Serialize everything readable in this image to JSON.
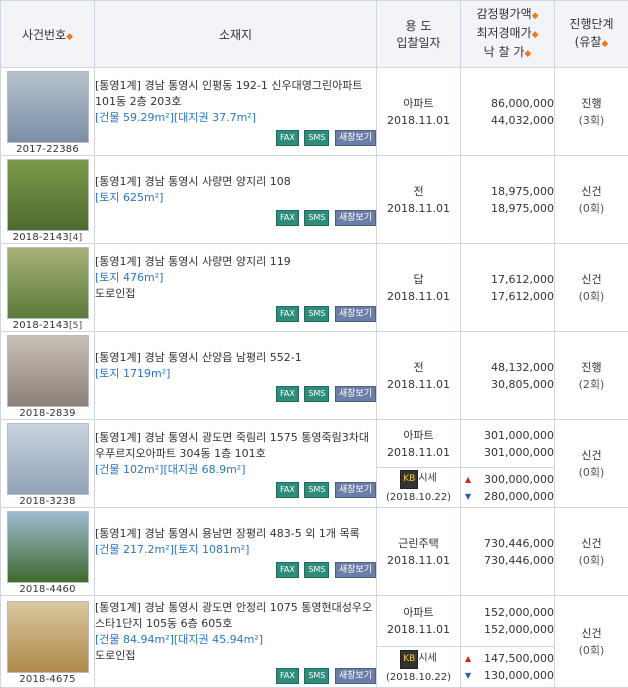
{
  "header": {
    "case": "사건번호",
    "location": "소재지",
    "usage_line1": "용 도",
    "usage_line2": "입찰일자",
    "price_line1": "감정평가액",
    "price_line2": "최저경매가",
    "price_line3": "낙 찰 가",
    "status_line1": "진행단계",
    "status_line2": "(유찰",
    "sort_glyph": "◆"
  },
  "buttons": {
    "fax": "FAX",
    "sms": "SMS",
    "new": "새창보기"
  },
  "rows": [
    {
      "case": "2017-22386",
      "case_sub": "",
      "court": "[통영1계]",
      "address": "경남 통영시 인평동 192-1 신우대영그린아파트 101동 2층 203호",
      "size": "[건물 59.29m²][대지권 37.7m²]",
      "note": "",
      "usage": "아파트",
      "date": "2018.11.01",
      "appraisal": "86,000,000",
      "minimum": "44,032,000",
      "status": "진행",
      "status_sub": "(3회)",
      "colors": [
        "#7a8fa6",
        "#b6c2cc"
      ]
    },
    {
      "case": "2018-2143",
      "case_sub": "[4]",
      "court": "[통영1계]",
      "address": "경남 통영시 사량면 양지리 108",
      "size": "[토지 625m²]",
      "note": "",
      "usage": "전",
      "date": "2018.11.01",
      "appraisal": "18,975,000",
      "minimum": "18,975,000",
      "status": "신건",
      "status_sub": "(0회)",
      "colors": [
        "#4d6b2e",
        "#7a9a4a"
      ]
    },
    {
      "case": "2018-2143",
      "case_sub": "[5]",
      "court": "[통영1계]",
      "address": "경남 통영시 사량면 양지리 119",
      "size": "[토지 476m²]",
      "note": "도로인접",
      "usage": "답",
      "date": "2018.11.01",
      "appraisal": "17,612,000",
      "minimum": "17,612,000",
      "status": "신건",
      "status_sub": "(0회)",
      "colors": [
        "#5b7a3a",
        "#a6b27a"
      ]
    },
    {
      "case": "2018-2839",
      "case_sub": "",
      "court": "[통영1계]",
      "address": "경남 통영시 산양읍 남평리 552-1",
      "size": "[토지 1719m²]",
      "note": "",
      "usage": "전",
      "date": "2018.11.01",
      "appraisal": "48,132,000",
      "minimum": "30,805,000",
      "status": "진행",
      "status_sub": "(2회)",
      "colors": [
        "#8a8078",
        "#c8bfb8"
      ]
    },
    {
      "case": "2018-3238",
      "case_sub": "",
      "court": "[통영1계]",
      "address": "경남 통영시 광도면 죽림리 1575 통영죽림3차대우푸르지오아파트 304동 1층 101호",
      "size": "[건물 102m²][대지권 68.9m²]",
      "note": "",
      "usage": "아파트",
      "date": "2018.11.01",
      "appraisal": "301,000,000",
      "minimum": "301,000,000",
      "market": {
        "label": "시세",
        "tag": "KB",
        "date": "(2018.10.22)",
        "high": "300,000,000",
        "low": "280,000,000"
      },
      "status": "신건",
      "status_sub": "(0회)",
      "colors": [
        "#8fa3b8",
        "#c9d4de"
      ]
    },
    {
      "case": "2018-4460",
      "case_sub": "",
      "court": "[통영1계]",
      "address": "경남 통영시 용남면 장평리 483-5 외 1개 목록",
      "size": "[건물 217.2m²][토지 1081m²]",
      "note": "",
      "usage": "근린주택",
      "date": "2018.11.01",
      "appraisal": "730,446,000",
      "minimum": "730,446,000",
      "status": "신건",
      "status_sub": "(0회)",
      "colors": [
        "#3f6a2e",
        "#9fbad0"
      ]
    },
    {
      "case": "2018-4675",
      "case_sub": "",
      "court": "[통영1계]",
      "address": "경남 통영시 광도면 안정리 1075 통영현대성우오스타1단지 105동 6층 605호",
      "size": "[건물 84.94m²][대지권 45.94m²]",
      "note": "도로인접",
      "usage": "아파트",
      "date": "2018.11.01",
      "appraisal": "152,000,000",
      "minimum": "152,000,000",
      "market": {
        "label": "시세",
        "tag": "KB",
        "date": "(2018.10.22)",
        "high": "147,500,000",
        "low": "130,000,000"
      },
      "status": "신건",
      "status_sub": "(0회)",
      "colors": [
        "#b08a4a",
        "#d8c8a0"
      ]
    }
  ],
  "icons": {
    "up": "▲",
    "down": "▼"
  }
}
